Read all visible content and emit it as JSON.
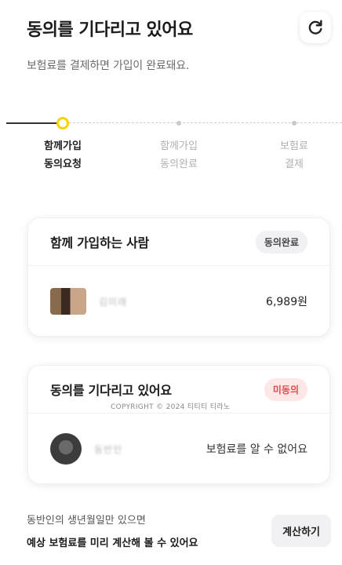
{
  "header": {
    "title": "동의를 기다리고 있어요",
    "subtitle": "보험료를 결제하면 가입이 완료돼요."
  },
  "stepper": {
    "steps": [
      {
        "line1": "함께가입",
        "line2": "동의요청",
        "active": true
      },
      {
        "line1": "함께가입",
        "line2": "동의완료",
        "active": false
      },
      {
        "line1": "보험료",
        "line2": "결제",
        "active": false
      }
    ]
  },
  "card_joined": {
    "title": "함께 가입하는 사람",
    "badge": "동의완료",
    "person_name": "김미래",
    "amount": "6,989원"
  },
  "card_waiting": {
    "title": "동의를 기다리고 있어요",
    "badge": "미동의",
    "person_name": "동반인",
    "notice": "보험료를 알 수 없어요"
  },
  "watermark": "COPYRIGHT © 2024 티티티 티라노",
  "footer": {
    "line1": "동반인의 생년월일만 있으면",
    "line2": "예상 보험료를 미리 계산해 볼 수 있어요",
    "calc_button": "계산하기"
  },
  "colors": {
    "accent_yellow": "#f5d400",
    "badge_pink_bg": "#fde7e7",
    "badge_pink_text": "#e0494f"
  },
  "icons": {
    "refresh": "refresh-icon"
  }
}
